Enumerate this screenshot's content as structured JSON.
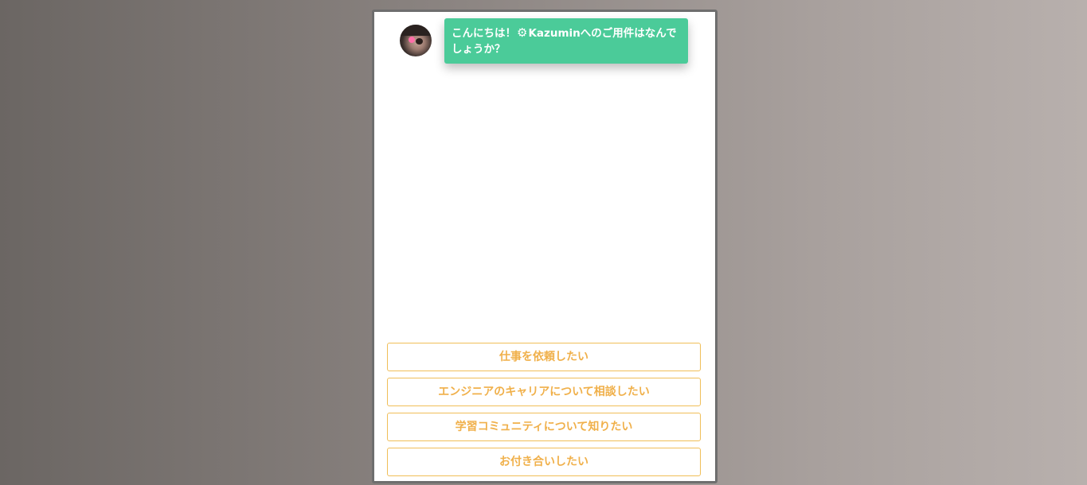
{
  "chat": {
    "greeting_prefix": "こんにちは！",
    "greeting_icon": "gear-icon",
    "greeting_suffix": "Kazuminへのご用件はなんでしょうか？",
    "bubble_color": "#4bcb99"
  },
  "choices": [
    "仕事を依頼したい",
    "エンジニアのキャリアについて相談したい",
    "学習コミュニティについて知りたい",
    "お付き合いしたい"
  ],
  "colors": {
    "choice_accent": "#f0b04a",
    "frame_border": "#6e6e6e"
  }
}
